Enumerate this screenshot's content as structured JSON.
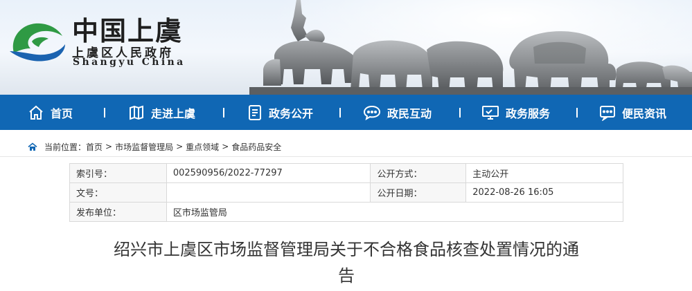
{
  "header": {
    "title": "中国上虞",
    "subtitle": "上虞区人民政府",
    "english": "Shangyu  China",
    "logo_colors": {
      "green": "#2f9a44",
      "blue": "#1b63b0"
    }
  },
  "nav": {
    "background": "#1067b4",
    "items": [
      {
        "label": "首页",
        "icon": "home-icon"
      },
      {
        "label": "走进上虞",
        "icon": "map-icon"
      },
      {
        "label": "政务公开",
        "icon": "document-icon"
      },
      {
        "label": "政民互动",
        "icon": "chat-icon"
      },
      {
        "label": "政务服务",
        "icon": "monitor-icon"
      },
      {
        "label": "便民资讯",
        "icon": "message-icon"
      }
    ]
  },
  "breadcrumb": {
    "prefix": "当前位置：",
    "items": [
      "首页",
      "市场监督管理局",
      "重点领域",
      "食品药品安全"
    ],
    "separator": ">"
  },
  "meta": {
    "rows": [
      {
        "k1": "索引号：",
        "v1": "002590956/2022-77297",
        "k2": "公开方式：",
        "v2": "主动公开"
      },
      {
        "k1": "文号：",
        "v1": "",
        "k2": "公开日期：",
        "v2": "2022-08-26 16:05"
      },
      {
        "k1": "发布单位：",
        "v1": "区市场监管局"
      }
    ]
  },
  "document": {
    "title_line1": "绍兴市上虞区市场监督管理局关于不合格食品核查处置情况的通",
    "title_line2": "告"
  }
}
